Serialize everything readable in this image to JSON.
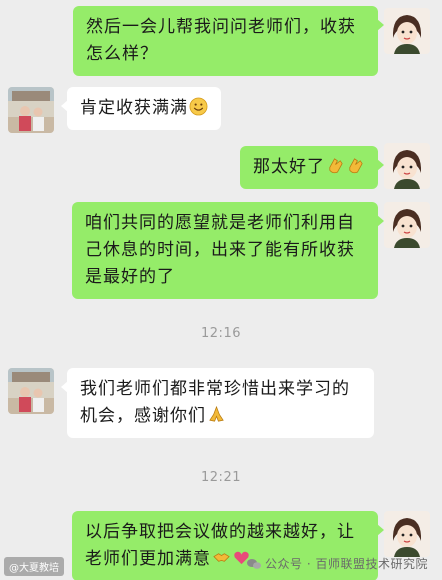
{
  "messages": [
    {
      "text_lines": [
        "然后一会儿帮我问问老师们，收获",
        "怎么样？"
      ],
      "sender": "me"
    },
    {
      "text": "肯定收获满满",
      "emoji": "smile-icon",
      "sender": "other"
    },
    {
      "text": "那太好了",
      "emoji": "clap-icon",
      "sender": "me"
    },
    {
      "text_lines": [
        "咱们共同的愿望就是老师们利用自",
        "己休息的时间，出来了能有所收获",
        "是最好的了"
      ],
      "sender": "me"
    },
    {
      "text_lines": [
        "我们老师们都非常珍惜出来学习的",
        "机会，感谢你们"
      ],
      "emoji": "pray-icon",
      "sender": "other"
    },
    {
      "text_lines": [
        "以后争取把会议做的越来越好，让",
        "老师们更加满意"
      ],
      "emoji": "handshake-heart-icon",
      "sender": "me"
    }
  ],
  "times": [
    "12:16",
    "12:21"
  ],
  "watermarks": {
    "left": "@大夏教培",
    "right": "公众号 · 百师联盟技术研究院"
  },
  "colors": {
    "background": "#ededed",
    "my_bubble": "#95ec69",
    "other_bubble": "#ffffff"
  }
}
